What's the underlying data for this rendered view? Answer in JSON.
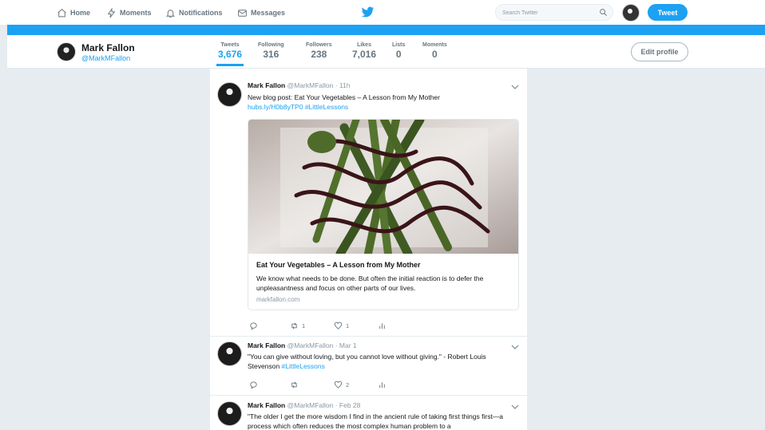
{
  "nav": {
    "home": "Home",
    "moments": "Moments",
    "notifications": "Notifications",
    "messages": "Messages",
    "search_placeholder": "Search Twitter",
    "tweet_button": "Tweet"
  },
  "profile": {
    "name": "Mark Fallon",
    "handle": "@MarkMFallon",
    "edit_button": "Edit profile",
    "stats": [
      {
        "label": "Tweets",
        "value": "3,676"
      },
      {
        "label": "Following",
        "value": "316"
      },
      {
        "label": "Followers",
        "value": "238"
      },
      {
        "label": "Likes",
        "value": "7,016"
      },
      {
        "label": "Lists",
        "value": "0"
      },
      {
        "label": "Moments",
        "value": "0"
      }
    ]
  },
  "tweets": [
    {
      "name": "Mark Fallon",
      "meta": "@MarkMFallon · 11h",
      "text": "New blog post: Eat Your Vegetables – A Lesson from My Mother",
      "link": "hubs.ly/H0b8yTP0",
      "hashtag": "#LittleLessons",
      "card": {
        "title": "Eat Your Vegetables – A Lesson from My Mother",
        "description": "We know what needs to be done. But often the initial reaction is to defer the unpleasantness and focus on other parts of our lives.",
        "domain": "markfallon.com"
      },
      "retweets": "1",
      "likes": "1"
    },
    {
      "name": "Mark Fallon",
      "meta": "@MarkMFallon · Mar 1",
      "text": "\"You can give without loving, but you cannot love without giving.\" - Robert Louis Stevenson",
      "hashtag": "#LittleLessons",
      "retweets": "",
      "likes": "2"
    },
    {
      "name": "Mark Fallon",
      "meta": "@MarkMFallon · Feb 28",
      "text": "\"The older I get the more wisdom I find in the ancient rule of taking first things first—a process which often reduces the most complex human problem to a"
    }
  ],
  "colors": {
    "accent": "#1da1f2",
    "background": "#e6ecf0",
    "text": "#14171a",
    "muted": "#66757f"
  }
}
